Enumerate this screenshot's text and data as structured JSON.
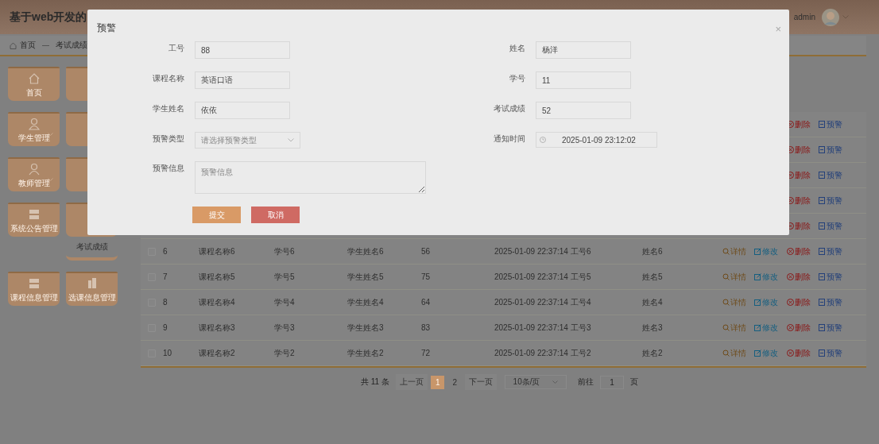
{
  "header": {
    "title": "基于web开发的",
    "user": "admin"
  },
  "breadcrumb": [
    "首页",
    "考试成绩"
  ],
  "sidebar": [
    {
      "kind": "tile",
      "label": "首页"
    },
    {
      "kind": "tile"
    },
    {
      "kind": "tile",
      "label": "学生管理",
      "expanded": false
    },
    {
      "kind": "tile"
    },
    {
      "kind": "tile",
      "label": "教师管理",
      "expanded": false
    },
    {
      "kind": "tile"
    },
    {
      "kind": "tile",
      "label": "系统公告管理",
      "expanded": false
    },
    {
      "kind": "tile",
      "children": [
        {
          "label": "考试成绩"
        }
      ]
    },
    {
      "kind": "tile",
      "label": "课程信息管理",
      "expanded": false
    },
    {
      "kind": "tile",
      "label": "选课信息管理",
      "expanded": false
    }
  ],
  "table": {
    "rows": [
      {
        "actions": [
          {
            "kind": "delete",
            "label": "删除"
          },
          {
            "kind": "warn",
            "label": "预警"
          }
        ]
      },
      {
        "actions": [
          {
            "kind": "delete",
            "label": "删除"
          },
          {
            "kind": "warn",
            "label": "预警"
          }
        ]
      },
      {
        "actions": [
          {
            "kind": "delete",
            "label": "删除"
          },
          {
            "kind": "warn",
            "label": "预警"
          }
        ]
      },
      {
        "actions": [
          {
            "kind": "delete",
            "label": "删除"
          },
          {
            "kind": "warn",
            "label": "预警"
          }
        ]
      },
      {
        "actions": [
          {
            "kind": "delete",
            "label": "删除"
          },
          {
            "kind": "warn",
            "label": "预警"
          }
        ]
      },
      {
        "checked": false,
        "cells": [
          "6",
          "课程名称6",
          "学号6",
          "学生姓名6",
          "56",
          "2025-01-09 22:37:14",
          "工号6",
          "姓名6"
        ],
        "actions": [
          {
            "kind": "detail",
            "label": "详情"
          },
          {
            "kind": "edit",
            "label": "修改"
          },
          {
            "kind": "delete",
            "label": "删除"
          },
          {
            "kind": "warn",
            "label": "预警"
          }
        ]
      },
      {
        "checked": false,
        "cells": [
          "7",
          "课程名称5",
          "学号5",
          "学生姓名5",
          "75",
          "2025-01-09 22:37:14",
          "工号5",
          "姓名5"
        ],
        "actions": [
          {
            "kind": "detail",
            "label": "详情"
          },
          {
            "kind": "edit",
            "label": "修改"
          },
          {
            "kind": "delete",
            "label": "删除"
          },
          {
            "kind": "warn",
            "label": "预警"
          }
        ]
      },
      {
        "checked": false,
        "cells": [
          "8",
          "课程名称4",
          "学号4",
          "学生姓名4",
          "64",
          "2025-01-09 22:37:14",
          "工号4",
          "姓名4"
        ],
        "actions": [
          {
            "kind": "detail",
            "label": "详情"
          },
          {
            "kind": "edit",
            "label": "修改"
          },
          {
            "kind": "delete",
            "label": "删除"
          },
          {
            "kind": "warn",
            "label": "预警"
          }
        ]
      },
      {
        "checked": false,
        "cells": [
          "9",
          "课程名称3",
          "学号3",
          "学生姓名3",
          "83",
          "2025-01-09 22:37:14",
          "工号3",
          "姓名3"
        ],
        "actions": [
          {
            "kind": "detail",
            "label": "详情"
          },
          {
            "kind": "edit",
            "label": "修改"
          },
          {
            "kind": "delete",
            "label": "删除"
          },
          {
            "kind": "warn",
            "label": "预警"
          }
        ]
      },
      {
        "checked": false,
        "cells": [
          "10",
          "课程名称2",
          "学号2",
          "学生姓名2",
          "72",
          "2025-01-09 22:37:14",
          "工号2",
          "姓名2"
        ],
        "actions": [
          {
            "kind": "detail",
            "label": "详情"
          },
          {
            "kind": "edit",
            "label": "修改"
          },
          {
            "kind": "delete",
            "label": "删除"
          },
          {
            "kind": "warn",
            "label": "预警"
          }
        ]
      }
    ]
  },
  "pagination": {
    "total": "共 11 条",
    "prev": "上一页",
    "pages": [
      {
        "label": "1",
        "selected": true
      },
      {
        "label": "2",
        "selected": false
      }
    ],
    "next": "下一页",
    "page_size": "10条/页",
    "goto": "前往",
    "goto_value": "1",
    "page_unit": "页"
  },
  "dialog": {
    "title": "预警",
    "close": "×",
    "fields": [
      {
        "kind": "text",
        "label": "工号",
        "value": "88"
      },
      {
        "kind": "text",
        "label": "姓名",
        "value": "杨洋"
      },
      {
        "kind": "text",
        "label": "课程名称",
        "value": "英语口语"
      },
      {
        "kind": "text",
        "label": "学号",
        "value": "11"
      },
      {
        "kind": "text",
        "label": "学生姓名",
        "value": "依依"
      },
      {
        "kind": "text",
        "label": "考试成绩",
        "value": "52"
      },
      {
        "kind": "select",
        "label": "预警类型",
        "placeholder": "请选择预警类型"
      },
      {
        "kind": "datetime",
        "label": "通知时间",
        "value": "2025-01-09 23:12:02"
      },
      {
        "kind": "textarea",
        "label": "预警信息",
        "placeholder": "预警信息"
      }
    ],
    "buttons": [
      {
        "kind": "primary",
        "label": "提交"
      },
      {
        "kind": "danger",
        "label": "取消"
      }
    ]
  }
}
